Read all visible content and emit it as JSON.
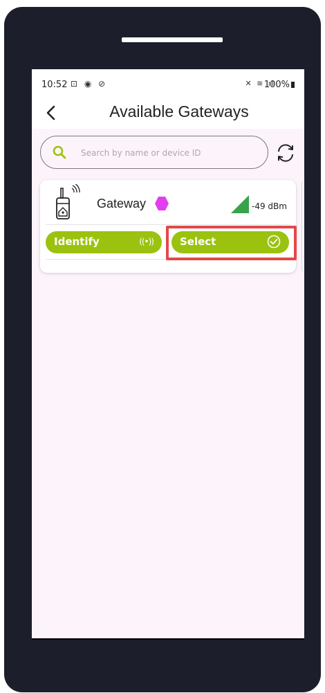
{
  "status_bar": {
    "time": "10:52",
    "battery": "100%"
  },
  "header": {
    "title": "Available Gateways"
  },
  "search": {
    "placeholder": "Search by name or device ID",
    "value": ""
  },
  "gateway": {
    "name": "Gateway",
    "signal": "-49 dBm",
    "identify_label": "Identify",
    "identify_icon": "((•))",
    "select_label": "Select"
  },
  "colors": {
    "accent": "#9bc20f",
    "badge": "#e23ef0",
    "signal": "#3aa24a",
    "highlight": "#e34848"
  }
}
